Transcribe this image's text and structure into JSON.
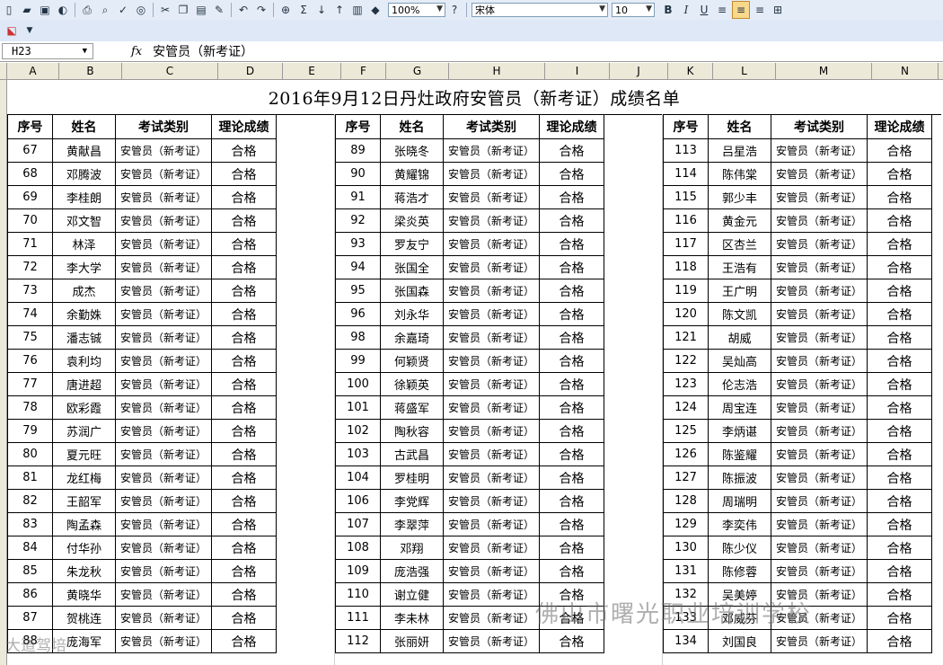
{
  "toolbar": {
    "zoom": "100%",
    "font_name": "宋体",
    "font_size": "10",
    "bold_label": "B",
    "italic_label": "I",
    "underline_label": "U",
    "sum_label": "Σ"
  },
  "formula_bar": {
    "cell_ref": "H23",
    "fx_label": "fx",
    "formula": "安管员（新考证）"
  },
  "columns": [
    "A",
    "B",
    "C",
    "D",
    "E",
    "F",
    "G",
    "H",
    "I",
    "J",
    "K",
    "L",
    "M",
    "N"
  ],
  "sheet": {
    "title": "2016年9月12日丹灶政府安管员（新考证）成绩名单",
    "headers": {
      "no": "序号",
      "name": "姓名",
      "category": "考试类别",
      "result": "理论成绩"
    },
    "category": "安管员（新考证）",
    "result": "合格",
    "blocks": [
      [
        {
          "no": "67",
          "name": "黄献昌"
        },
        {
          "no": "68",
          "name": "邓腾波"
        },
        {
          "no": "69",
          "name": "李桂朗"
        },
        {
          "no": "70",
          "name": "邓文智"
        },
        {
          "no": "71",
          "name": "林泽"
        },
        {
          "no": "72",
          "name": "李大学"
        },
        {
          "no": "73",
          "name": "成杰"
        },
        {
          "no": "74",
          "name": "余勤姝"
        },
        {
          "no": "75",
          "name": "潘志铖"
        },
        {
          "no": "76",
          "name": "袁利均"
        },
        {
          "no": "77",
          "name": "唐进超"
        },
        {
          "no": "78",
          "name": "欧彩霞"
        },
        {
          "no": "79",
          "name": "苏润广"
        },
        {
          "no": "80",
          "name": "夏元旺"
        },
        {
          "no": "81",
          "name": "龙红梅"
        },
        {
          "no": "82",
          "name": "王韶军"
        },
        {
          "no": "83",
          "name": "陶孟森"
        },
        {
          "no": "84",
          "name": "付华孙"
        },
        {
          "no": "85",
          "name": "朱龙秋"
        },
        {
          "no": "86",
          "name": "黄晓华"
        },
        {
          "no": "87",
          "name": "贺桃连"
        },
        {
          "no": "88",
          "name": "庞海军"
        }
      ],
      [
        {
          "no": "89",
          "name": "张晓冬"
        },
        {
          "no": "90",
          "name": "黄耀锦"
        },
        {
          "no": "91",
          "name": "蒋浩才"
        },
        {
          "no": "92",
          "name": "梁炎英"
        },
        {
          "no": "93",
          "name": "罗友宁"
        },
        {
          "no": "94",
          "name": "张国全"
        },
        {
          "no": "95",
          "name": "张国森"
        },
        {
          "no": "96",
          "name": "刘永华"
        },
        {
          "no": "98",
          "name": "余嘉琦"
        },
        {
          "no": "99",
          "name": "何颖贤"
        },
        {
          "no": "100",
          "name": "徐颖英"
        },
        {
          "no": "101",
          "name": "蒋盛军"
        },
        {
          "no": "102",
          "name": "陶秋容"
        },
        {
          "no": "103",
          "name": "古武昌"
        },
        {
          "no": "104",
          "name": "罗桂明"
        },
        {
          "no": "106",
          "name": "李党辉"
        },
        {
          "no": "107",
          "name": "李翠萍"
        },
        {
          "no": "108",
          "name": "邓翔"
        },
        {
          "no": "109",
          "name": "庞浩强"
        },
        {
          "no": "110",
          "name": "谢立健"
        },
        {
          "no": "111",
          "name": "李未林"
        },
        {
          "no": "112",
          "name": "张丽妍"
        }
      ],
      [
        {
          "no": "113",
          "name": "吕星浩"
        },
        {
          "no": "114",
          "name": "陈伟棠"
        },
        {
          "no": "115",
          "name": "郭少丰"
        },
        {
          "no": "116",
          "name": "黄金元"
        },
        {
          "no": "117",
          "name": "区杏兰"
        },
        {
          "no": "118",
          "name": "王浩有"
        },
        {
          "no": "119",
          "name": "王广明"
        },
        {
          "no": "120",
          "name": "陈文凯"
        },
        {
          "no": "121",
          "name": "胡威"
        },
        {
          "no": "122",
          "name": "吴灿高"
        },
        {
          "no": "123",
          "name": "伦志浩"
        },
        {
          "no": "124",
          "name": "周宝连"
        },
        {
          "no": "125",
          "name": "李炳谌"
        },
        {
          "no": "126",
          "name": "陈鉴耀"
        },
        {
          "no": "127",
          "name": "陈振波"
        },
        {
          "no": "128",
          "name": "周瑞明"
        },
        {
          "no": "129",
          "name": "李奕伟"
        },
        {
          "no": "130",
          "name": "陈少仪"
        },
        {
          "no": "131",
          "name": "陈修蓉"
        },
        {
          "no": "132",
          "name": "吴美婷"
        },
        {
          "no": "133",
          "name": "邓威芬"
        },
        {
          "no": "134",
          "name": "刘国良"
        }
      ]
    ]
  },
  "watermark": "佛山市曙光职业培训学校",
  "watermark2": "大道驾培"
}
